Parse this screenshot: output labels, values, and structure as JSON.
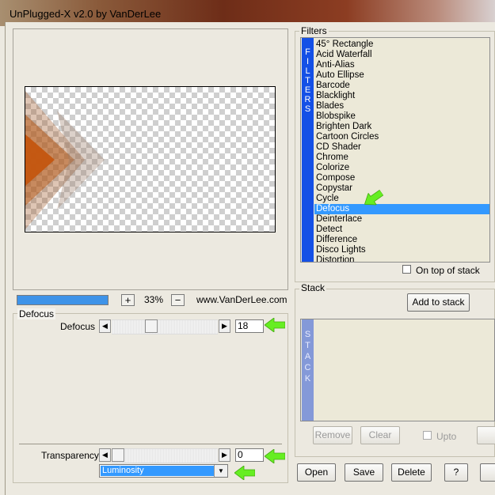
{
  "window": {
    "title": "UnPlugged-X v2.0 by VanDerLee"
  },
  "preview": {
    "zoom_plus": "+",
    "zoom_label": "33%",
    "zoom_minus": "−",
    "site": "www.VanDerLee.com",
    "progress": 1.0
  },
  "params": {
    "group_title": "Defocus",
    "defocus": {
      "label": "Defocus",
      "value": "18"
    },
    "transparency": {
      "label": "Transparency",
      "value": "0"
    },
    "blend_mode": "Luminosity"
  },
  "filters": {
    "group_title": "Filters",
    "band_letters": [
      "F",
      "I",
      "L",
      "T",
      "E",
      "R",
      "S"
    ],
    "items": [
      "45° Rectangle",
      "Acid Waterfall",
      "Anti-Alias",
      "Auto Ellipse",
      "Barcode",
      "Blacklight",
      "Blades",
      "Blobspike",
      "Brighten Dark",
      "Cartoon Circles",
      "CD Shader",
      "Chrome",
      "Colorize",
      "Compose",
      "Copystar",
      "Cycle",
      "Defocus",
      "Deinterlace",
      "Detect",
      "Difference",
      "Disco Lights",
      "Distortion"
    ],
    "selected": "Defocus",
    "on_top_label": "On top of stack"
  },
  "stack": {
    "group_title": "Stack",
    "add_label": "Add to stack",
    "band_letters": [
      "S",
      "T",
      "A",
      "C",
      "K"
    ],
    "remove_label": "Remove",
    "clear_label": "Clear",
    "upto_label": "Upto"
  },
  "footer": {
    "open_label": "Open",
    "save_label": "Save",
    "delete_label": "Delete",
    "help_label": "?"
  },
  "colors": {
    "accent_green": "#66ee22",
    "band_blue": "#1450e6",
    "selection": "#3399ff"
  }
}
